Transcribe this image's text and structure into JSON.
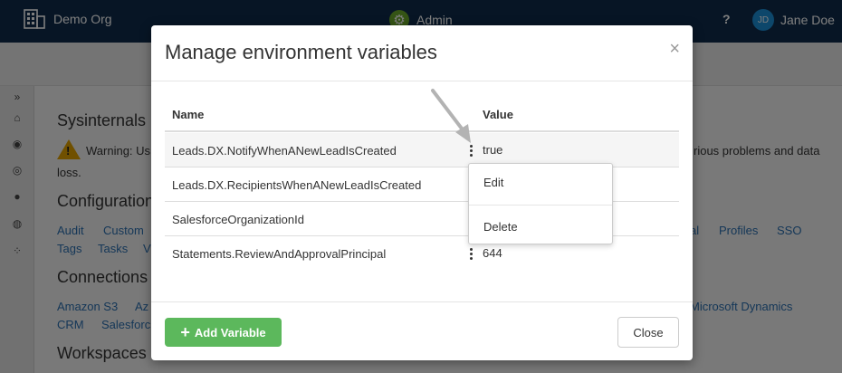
{
  "topbar": {
    "org_name": "Demo Org",
    "app_name": "Admin",
    "help_label": "?",
    "user_initials": "JD",
    "user_name": "Jane Doe"
  },
  "background": {
    "sysinternals_title": "Sysinternals",
    "warning_text_start": "Warning: Us",
    "warning_text_end": "rious problems and data",
    "warning_text_line2": "loss.",
    "configuration_title": "Configuration",
    "config_links_row1": [
      "Audit",
      "Custom",
      "al",
      "Profiles",
      "SSO"
    ],
    "config_links_row2": [
      "Tags",
      "Tasks",
      "V"
    ],
    "connections_title": "Connections",
    "connection_links_row1": [
      "Amazon S3",
      "Az",
      "Microsoft Dynamics"
    ],
    "connection_links_row2": [
      "CRM",
      "Salesforc"
    ],
    "workspaces_title": "Workspaces"
  },
  "modal": {
    "title": "Manage environment variables",
    "close_symbol": "×",
    "columns": {
      "name": "Name",
      "value": "Value"
    },
    "rows": [
      {
        "name": "Leads.DX.NotifyWhenANewLeadIsCreated",
        "value": "true"
      },
      {
        "name": "Leads.DX.RecipientsWhenANewLeadIsCreated",
        "value": ""
      },
      {
        "name": "SalesforceOrganizationId",
        "value": ""
      },
      {
        "name": "Statements.ReviewAndApprovalPrincipal",
        "value": "644"
      }
    ],
    "context_menu": {
      "edit": "Edit",
      "delete": "Delete"
    },
    "add_button": "Add Variable",
    "close_button": "Close"
  },
  "colors": {
    "topbar": "#0f2b4a",
    "add_button": "#5cb85c",
    "link": "#2a6fb0",
    "avatar": "#1b8fd6"
  }
}
